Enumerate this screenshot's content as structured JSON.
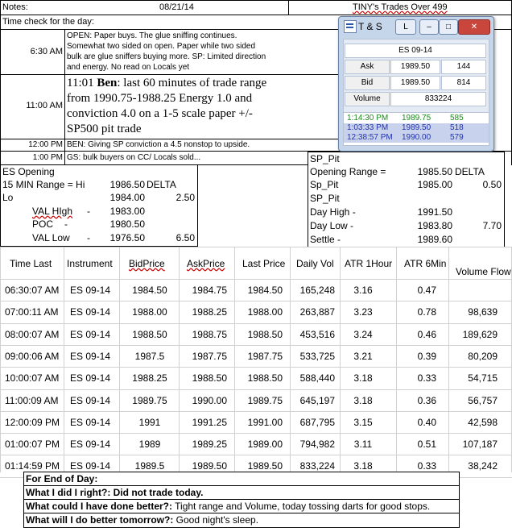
{
  "header": {
    "notes_label": "Notes:",
    "date": "08/21/14",
    "title": "TINY's Trades Over 499",
    "time_check": "Time check for the day:"
  },
  "notes": [
    {
      "time": "6:30 AM",
      "text": [
        "OPEN: Paper buys. The glue sniffing continues.",
        "Somewhat two sided on open. Paper while two sided",
        "bulk are glue sniffers buying more.  SP: Limited direction",
        "and energy.  No read on Locals yet"
      ]
    },
    {
      "time": "11:00 AM",
      "text_prefix": "11:01 ",
      "text_bold": "Ben",
      "text": [
        ": last 60 minutes of trade range",
        "from 1990.75-1988.25 Energy 1.0 and",
        "conviction 4.0 on a 1-5 scale paper +/-",
        "SP500 pit trade"
      ]
    },
    {
      "time": "12:00 PM",
      "text": [
        "BEN: Giving SP conviction a 4.5 nonstop to upside."
      ]
    },
    {
      "time": "1:00 PM",
      "text": [
        "GS: bulk buyers on CC/ Locals sold..."
      ]
    }
  ],
  "ts_window": {
    "title": "T & S",
    "tab_label": "L",
    "symbol": "ES 09-14",
    "rows": [
      {
        "label": "Ask",
        "price": "1989.50",
        "size": "144"
      },
      {
        "label": "Bid",
        "price": "1989.50",
        "size": "814"
      }
    ],
    "volume_label": "Volume",
    "volume_value": "833224",
    "feed": [
      {
        "time": "1:14:30 PM",
        "price": "1989.75",
        "size": "585",
        "color": "#1a8a1a"
      },
      {
        "time": "1:03:33 PM",
        "price": "1989.50",
        "size": "518",
        "color": "#2233aa"
      },
      {
        "time": "12:38:57 PM",
        "price": "1990.00",
        "size": "579",
        "color": "#2233aa"
      }
    ]
  },
  "es_opening": {
    "title": "ES Opening",
    "range_label": "15 MIN Range = Hi",
    "hi": "1986.50",
    "delta_label": "DELTA",
    "lo_label": "Lo",
    "lo": "1984.00",
    "delta": "2.50",
    "val_high_label": "VAL HIgh",
    "val_high": "1983.00",
    "poc_label": "POC",
    "poc": "1980.50",
    "val_low_label": "VAL Low",
    "val_low": "1976.50",
    "val_delta": "6.50",
    "dash": "-"
  },
  "sp_pit": {
    "title": "SP_Pit",
    "opening_range_label": "Opening Range =",
    "opening_range": "1985.50",
    "delta_label": "DELTA",
    "sp_pit_label": "Sp_Pit",
    "sp_pit_value": "1985.00",
    "sp_pit_delta": "0.50",
    "title2": "SP_Pit",
    "day_high_label": "Day High -",
    "day_high": "1991.50",
    "day_low_label": "Day Low -",
    "day_low": "1983.80",
    "day_delta": "7.70",
    "settle_label": "Settle -",
    "settle": "1989.60"
  },
  "table": {
    "headers": [
      "Time Last",
      "Instrument",
      "BidPrice",
      "AskPrice",
      "Last Price",
      "Daily Vol",
      "ATR 1Hour",
      "ATR 6Min",
      "Volume Flow"
    ],
    "rows": [
      [
        "06:30:07 AM",
        "ES 09-14",
        "1984.50",
        "1984.75",
        "1984.50",
        "165,248",
        "3.16",
        "0.47",
        ""
      ],
      [
        "07:00:11 AM",
        "ES 09-14",
        "1988.00",
        "1988.25",
        "1988.00",
        "263,887",
        "3.23",
        "0.78",
        "98,639"
      ],
      [
        "08:00:07 AM",
        "ES 09-14",
        "1988.50",
        "1988.75",
        "1988.50",
        "453,516",
        "3.24",
        "0.46",
        "189,629"
      ],
      [
        "09:00:06 AM",
        "ES 09-14",
        "1987.5",
        "1987.75",
        "1987.75",
        "533,725",
        "3.21",
        "0.39",
        "80,209"
      ],
      [
        "10:00:07 AM",
        "ES 09-14",
        "1988.25",
        "1988.50",
        "1988.50",
        "588,440",
        "3.18",
        "0.33",
        "54,715"
      ],
      [
        "11:00:09 AM",
        "ES 09-14",
        "1989.75",
        "1990.00",
        "1989.75",
        "645,197",
        "3.18",
        "0.36",
        "56,757"
      ],
      [
        "12:00:09 PM",
        "ES 09-14",
        "1991",
        "1991.25",
        "1991.00",
        "687,795",
        "3.15",
        "0.40",
        "42,598"
      ],
      [
        "01:00:07 PM",
        "ES 09-14",
        "1989",
        "1989.25",
        "1989.00",
        "794,982",
        "3.11",
        "0.51",
        "107,187"
      ],
      [
        "01:14:59 PM",
        "ES 09-14",
        "1989.5",
        "1989.50",
        "1989.50",
        "833,224",
        "3.18",
        "0.33",
        "38,242"
      ]
    ]
  },
  "end_of_day": {
    "title": "For End of Day:",
    "q1": "What I did I right?:",
    "a1": "Did not trade today.",
    "q2": "What could I have done better?:",
    "a2": "Tight range and Volume, today tossing darts for good stops.",
    "q3": "What will I do better tomorrow?:",
    "a3": "Good night's sleep."
  }
}
